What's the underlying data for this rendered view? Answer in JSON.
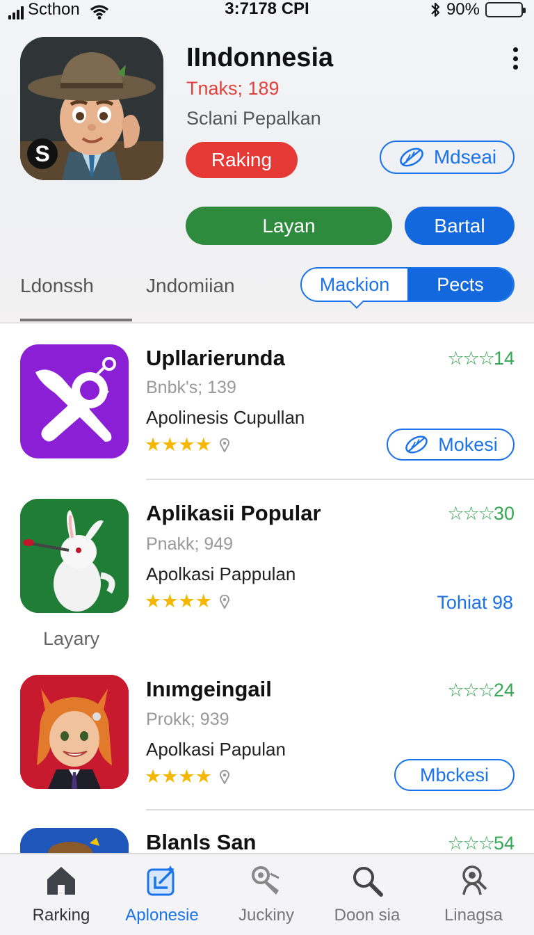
{
  "status_bar": {
    "carrier": "Scthon",
    "time": "3:7178 CPI",
    "battery": "90%",
    "battery_level": 0.4,
    "icons": [
      "signal-icon",
      "wifi-icon",
      "bluetooth-icon",
      "battery-icon"
    ]
  },
  "header": {
    "title": "IIndonnesia",
    "subtitle": "Tnaks; 189",
    "description": "Sclani Pepalkan",
    "badge_letter": "S",
    "buttons": {
      "raking": "Raking",
      "mdseai": "Mdseai",
      "layan": "Layan",
      "bartal": "Bartal"
    }
  },
  "tabs": {
    "tab1": "Ldonssh",
    "tab2": "Jndomiian",
    "segment_left": "Mackion",
    "segment_right": "Pects"
  },
  "items": [
    {
      "title": "Upllarierunda",
      "meta": "Bnbk's; 139",
      "desc": "Apolinesis Cupullan",
      "rating": "14",
      "stars": "★★★★",
      "action": "Mokesi"
    },
    {
      "title": "Aplikasii Popular",
      "meta": "Pnakk; 949",
      "desc": "Apolkasi Pappulan",
      "rating": "30",
      "stars": "★★★★",
      "link": "Tohiat 98",
      "caption": "Layary"
    },
    {
      "title": "Inımgeingail",
      "meta": "Prokk; 939",
      "desc": "Apolkasi Papulan",
      "rating": "24",
      "stars": "★★★★",
      "action": "Mbckesi"
    },
    {
      "title": "Blanls San",
      "rating": "54"
    }
  ],
  "rating_glyphs": "☆☆☆",
  "tabbar": [
    {
      "label": "Rarking",
      "icon": "home-icon"
    },
    {
      "label": "Aplonesie",
      "icon": "edit-app-icon"
    },
    {
      "label": "Juckiny",
      "icon": "tool-icon"
    },
    {
      "label": "Doon sia",
      "icon": "search-icon"
    },
    {
      "label": "Linagsa",
      "icon": "profile-search-icon"
    }
  ],
  "colors": {
    "accent_blue": "#1a73e8",
    "red": "#e53935",
    "green": "#2e8b3e",
    "star_yellow": "#f5b700",
    "rating_green": "#34a853"
  }
}
